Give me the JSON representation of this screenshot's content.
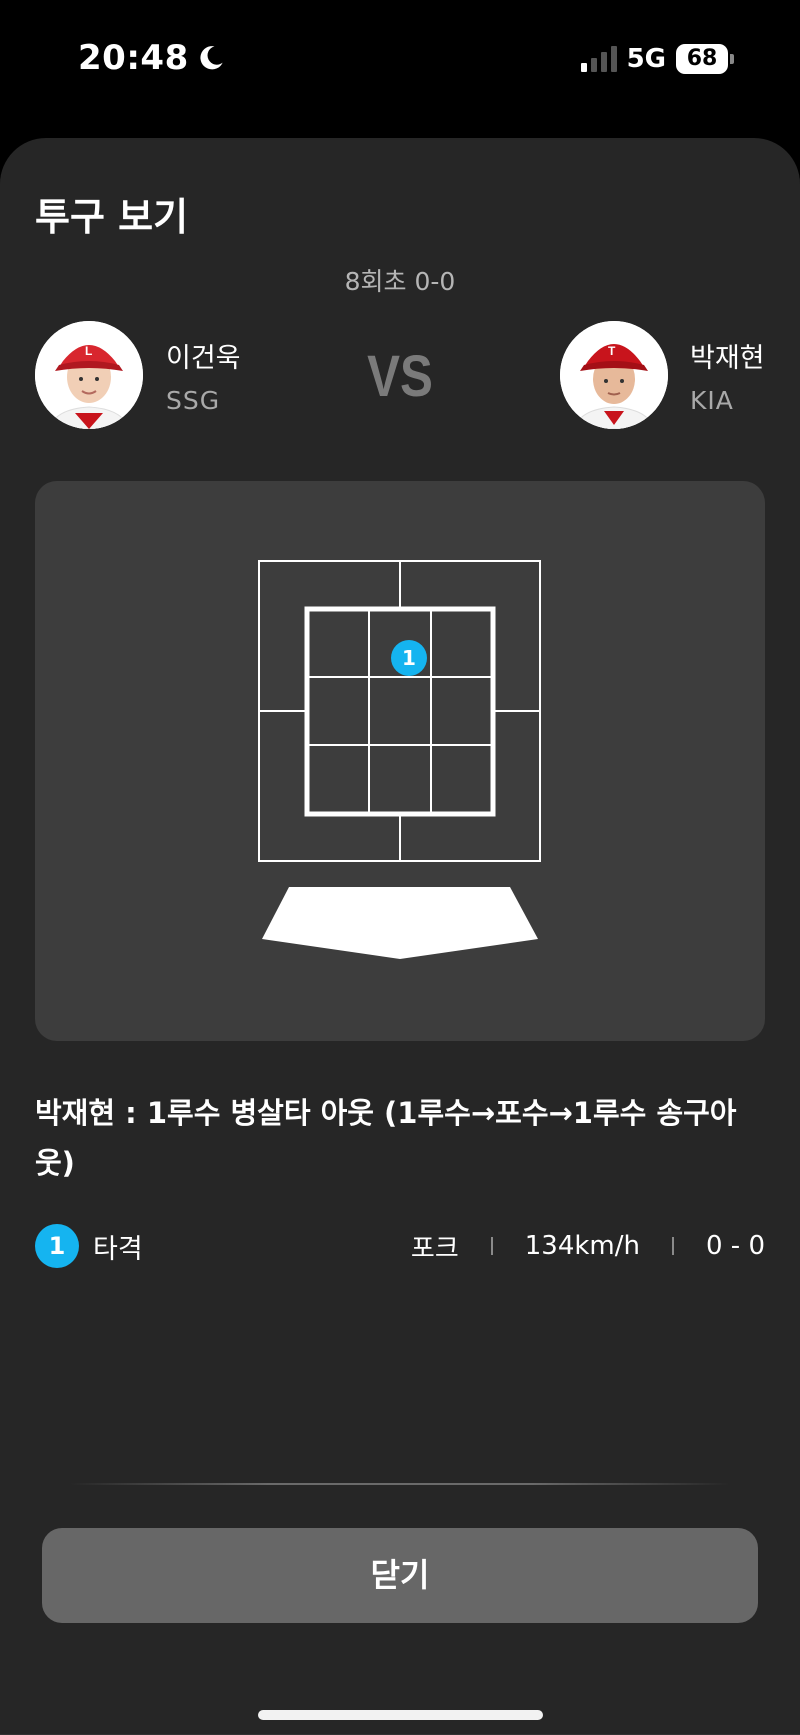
{
  "status_bar": {
    "time": "20:48",
    "moon_icon": "moon-icon",
    "network": "5G",
    "battery": "68",
    "signal_icon": "signal-bars-icon"
  },
  "sheet": {
    "title": "투구 보기",
    "inning": "8회초 0-0",
    "vs_label": "VS"
  },
  "pitcher": {
    "name": "이건욱",
    "team": "SSG",
    "avatar_icon": "player-photo-icon",
    "cap_color": "#d8262e"
  },
  "batter": {
    "name": "박재현",
    "team": "KIA",
    "avatar_icon": "player-photo-icon",
    "cap_color": "#c8141c"
  },
  "zone": {
    "marker_label": "1",
    "marker_color": "#15b4f0"
  },
  "result_text": "박재현 : 1루수 병살타 아웃 (1루수→포수→1루수 송구아웃)",
  "pitches": [
    {
      "number": "1",
      "result": "타격",
      "pitch_type": "포크",
      "speed": "134km/h",
      "count": "0 - 0"
    }
  ],
  "close_label": "닫기"
}
